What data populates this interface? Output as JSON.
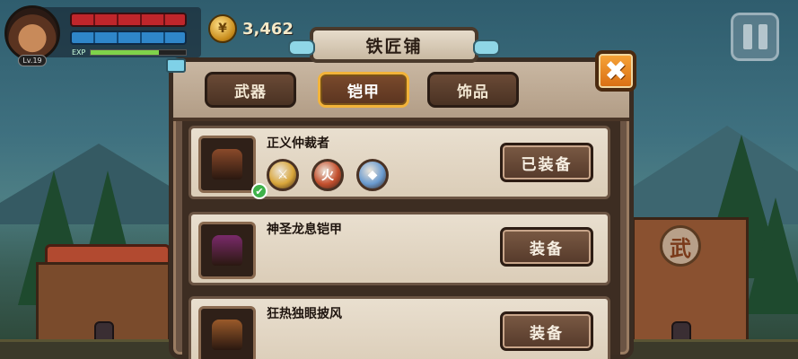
{
  "hud": {
    "level": "Lv.19",
    "exp_label": "EXP",
    "exp_fraction": 0.72,
    "gold": "3,462",
    "coin_glyph": "¥"
  },
  "dialog": {
    "title": "铁匠铺",
    "close_glyph": "✖",
    "tabs": [
      {
        "label": "武器",
        "active": false
      },
      {
        "label": "铠甲",
        "active": true
      },
      {
        "label": "饰品",
        "active": false
      }
    ],
    "items": [
      {
        "name": "正义仲裁者",
        "button": "已装备",
        "equipped": true,
        "armor_color": "#8a4a2a",
        "sockets": [
          {
            "icon": "shield-emblem",
            "color": "#d9a63a",
            "glyph": "⚔"
          },
          {
            "icon": "fire-emblem",
            "color": "#c4502e",
            "glyph": "火"
          },
          {
            "icon": "defense-emblem",
            "color": "#6a9bd0",
            "glyph": "◆"
          }
        ]
      },
      {
        "name": "神圣龙息铠甲",
        "button": "装备",
        "equipped": false,
        "armor_color": "#7a2a6a",
        "sockets": []
      },
      {
        "name": "狂热独眼披风",
        "button": "装备",
        "equipped": false,
        "armor_color": "#9a5a2a",
        "sockets": []
      }
    ]
  },
  "scenery": {
    "shop_sign": "武"
  },
  "colors": {
    "hp": "#c0262b",
    "mp": "#2f86c9",
    "exp": "#7fd24a",
    "close_button": "#f7a53a",
    "active_tab_border": "#f2b33a"
  }
}
